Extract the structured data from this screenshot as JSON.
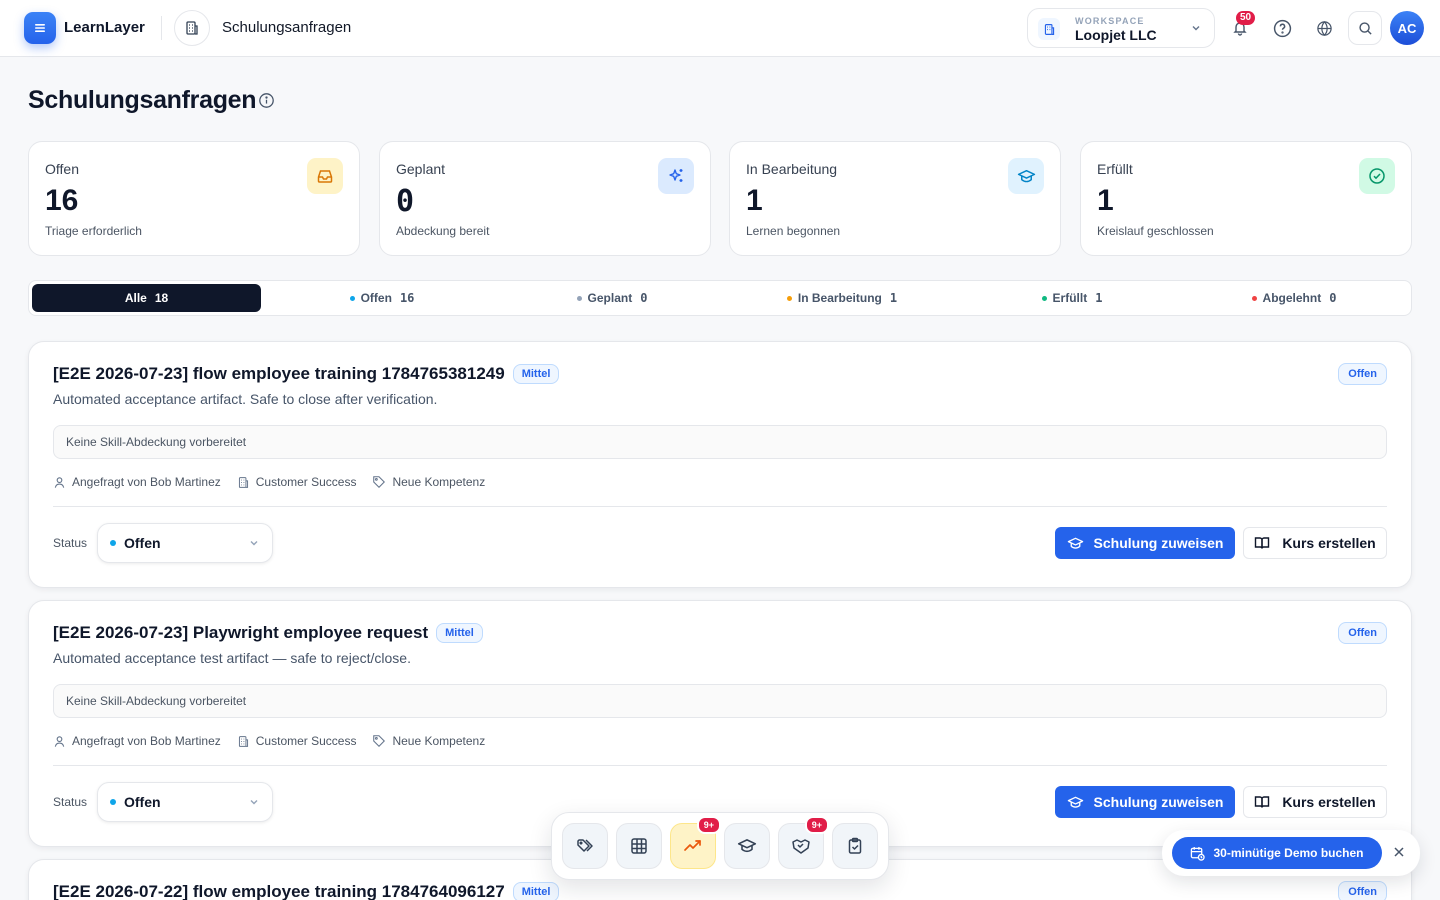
{
  "app": {
    "name": "LearnLayer"
  },
  "header": {
    "page_title": "Schulungsanfragen",
    "workspace_label": "WORKSPACE",
    "workspace_name": "Loopjet LLC",
    "notifications_count": "50",
    "avatar_initials": "AC"
  },
  "page": {
    "title": "Schulungsanfragen"
  },
  "stats": [
    {
      "label": "Offen",
      "value": "16",
      "sub": "Triage erforderlich",
      "icon": "inbox-icon",
      "color": "#d97706"
    },
    {
      "label": "Geplant",
      "value": "0",
      "sub": "Abdeckung bereit",
      "icon": "sparkles-icon",
      "color": "#2563eb"
    },
    {
      "label": "In Bearbeitung",
      "value": "1",
      "sub": "Lernen begonnen",
      "icon": "graduation-cap-icon",
      "color": "#0284c7"
    },
    {
      "label": "Erfüllt",
      "value": "1",
      "sub": "Kreislauf geschlossen",
      "icon": "check-circle-icon",
      "color": "#059669"
    }
  ],
  "tabs": [
    {
      "label": "Alle",
      "count": "18",
      "active": true
    },
    {
      "label": "Offen",
      "count": "16",
      "dot": "#0ea5e9"
    },
    {
      "label": "Geplant",
      "count": "0",
      "dot": "#94a3b8"
    },
    {
      "label": "In Bearbeitung",
      "count": "1",
      "dot": "#f59e0b"
    },
    {
      "label": "Erfüllt",
      "count": "1",
      "dot": "#10b981"
    },
    {
      "label": "Abgelehnt",
      "count": "0",
      "dot": "#ef4444"
    }
  ],
  "requests": [
    {
      "title": "[E2E 2026-07-23] flow employee training 1784765381249",
      "priority": "Mittel",
      "status_badge": "Offen",
      "description": "Automated acceptance artifact. Safe to close after verification.",
      "skill_coverage": "Keine Skill-Abdeckung vorbereitet",
      "requested_by": "Angefragt von Bob Martinez",
      "department": "Customer Success",
      "category": "Neue Kompetenz",
      "status_label": "Status",
      "status_value": "Offen",
      "assign_label": "Schulung zuweisen",
      "create_label": "Kurs erstellen"
    },
    {
      "title": "[E2E 2026-07-23] Playwright employee request",
      "priority": "Mittel",
      "status_badge": "Offen",
      "description": "Automated acceptance test artifact — safe to reject/close.",
      "skill_coverage": "Keine Skill-Abdeckung vorbereitet",
      "requested_by": "Angefragt von Bob Martinez",
      "department": "Customer Success",
      "category": "Neue Kompetenz",
      "status_label": "Status",
      "status_value": "Offen",
      "assign_label": "Schulung zuweisen",
      "create_label": "Kurs erstellen"
    },
    {
      "title": "[E2E 2026-07-22] flow employee training 1784764096127",
      "priority": "Mittel",
      "status_badge": "Offen"
    }
  ],
  "dock": {
    "items": [
      {
        "icon": "tags-icon"
      },
      {
        "icon": "grid-icon"
      },
      {
        "icon": "trending-up-icon",
        "badge": "9+",
        "active": true
      },
      {
        "icon": "graduation-cap-icon"
      },
      {
        "icon": "handshake-icon",
        "badge": "9+"
      },
      {
        "icon": "clipboard-check-icon"
      }
    ]
  },
  "demo": {
    "label": "30-minütige Demo buchen"
  }
}
